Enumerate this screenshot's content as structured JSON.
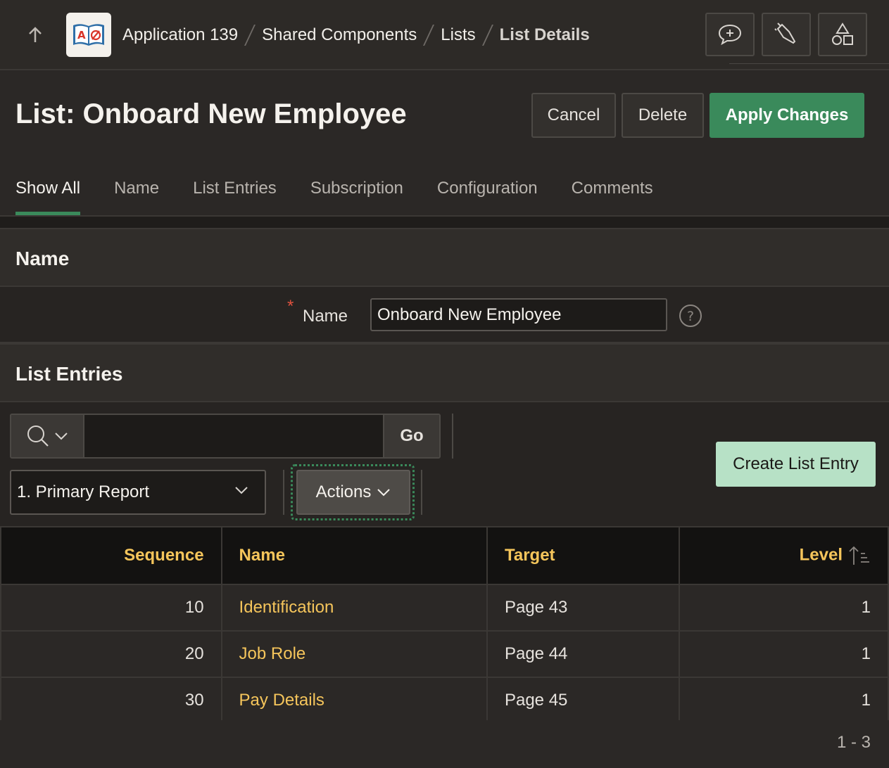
{
  "breadcrumb": {
    "items": [
      "Application 139",
      "Shared Components",
      "Lists"
    ],
    "current": "List Details"
  },
  "page": {
    "title": "List: Onboard New Employee",
    "buttons": {
      "cancel": "Cancel",
      "delete": "Delete",
      "apply": "Apply Changes"
    }
  },
  "tabs": [
    "Show All",
    "Name",
    "List Entries",
    "Subscription",
    "Configuration",
    "Comments"
  ],
  "name_section": {
    "heading": "Name",
    "required_mark": "*",
    "label": "Name",
    "value": "Onboard New Employee",
    "help": "?"
  },
  "list_entries": {
    "heading": "List Entries",
    "search_value": "",
    "go_label": "Go",
    "report_select": "1. Primary Report",
    "actions_label": "Actions",
    "create_label": "Create List Entry",
    "columns": {
      "sequence": "Sequence",
      "name": "Name",
      "target": "Target",
      "level": "Level"
    },
    "rows": [
      {
        "sequence": "10",
        "name": "Identification",
        "target": "Page 43",
        "level": "1"
      },
      {
        "sequence": "20",
        "name": "Job Role",
        "target": "Page 44",
        "level": "1"
      },
      {
        "sequence": "30",
        "name": "Pay Details",
        "target": "Page 45",
        "level": "1"
      }
    ],
    "pagination": "1 - 3"
  },
  "colors": {
    "accent": "#3a8a5b",
    "link": "#f5c55b",
    "create": "#b7e1c6",
    "required": "#e0523f"
  }
}
